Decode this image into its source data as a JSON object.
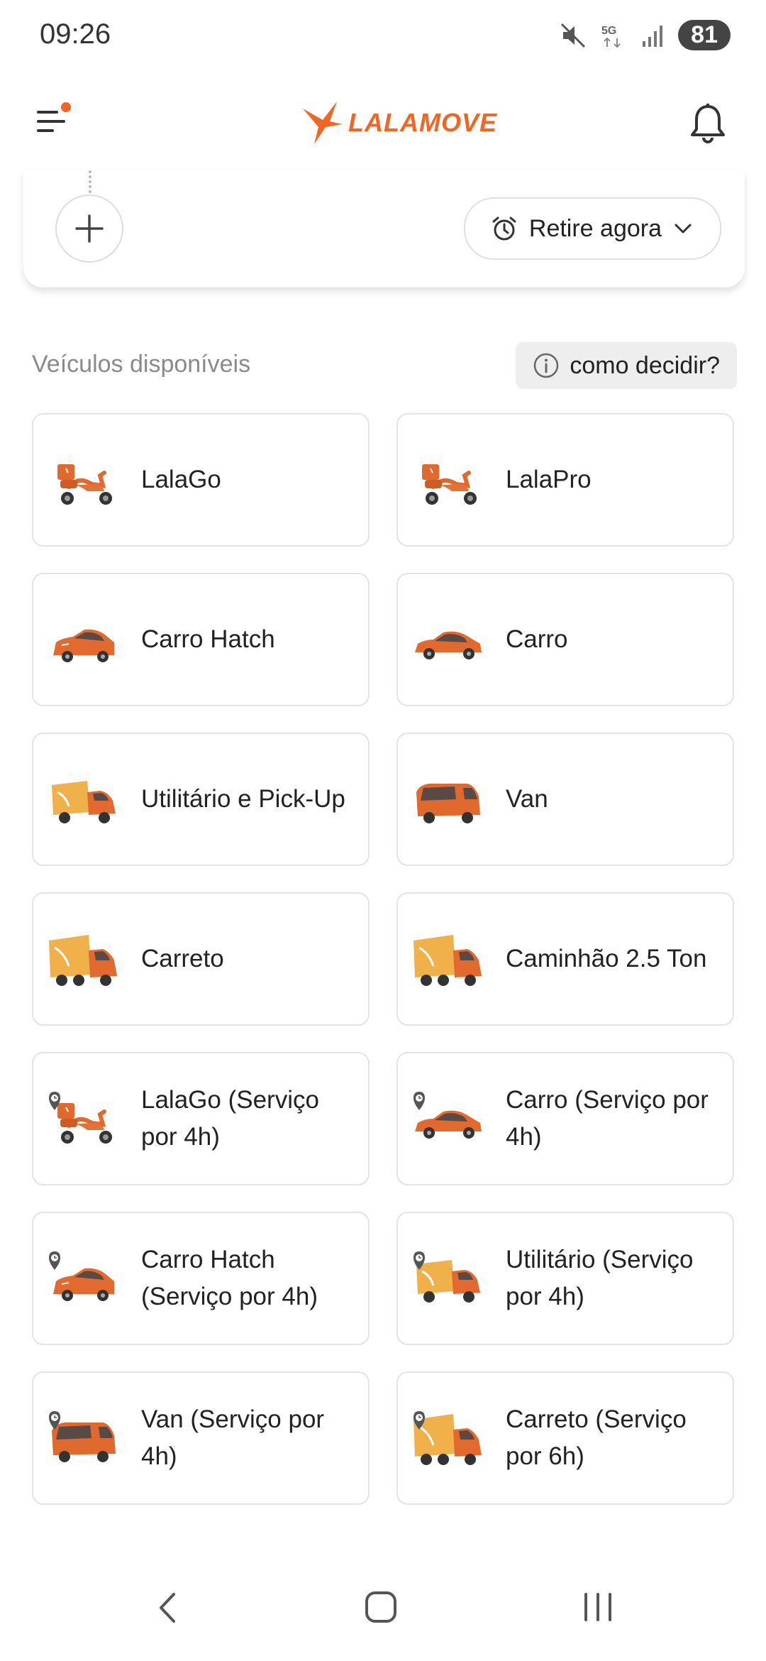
{
  "status_bar": {
    "time": "09:26",
    "battery": "81",
    "network": "5G",
    "icons": [
      "mute-icon",
      "5g-icon",
      "signal-icon",
      "battery-icon"
    ]
  },
  "header": {
    "brand": "LALAMOVE",
    "brand_color": "#f16622",
    "icons": [
      "menu-icon",
      "notification-bell-icon"
    ]
  },
  "order_card": {
    "pickup_time_label": "Retire agora",
    "icons": [
      "add-icon",
      "alarm-clock-icon",
      "chevron-down-icon"
    ]
  },
  "vehicles_section": {
    "title": "Veículos disponíveis",
    "help_label": "como decidir?",
    "help_icon": "info-icon",
    "items": [
      {
        "label": "LalaGo",
        "icon": "scooter-icon",
        "timed": false
      },
      {
        "label": "LalaPro",
        "icon": "scooter-icon",
        "timed": false
      },
      {
        "label": "Carro Hatch",
        "icon": "hatchback-car-icon",
        "timed": false
      },
      {
        "label": "Carro",
        "icon": "sedan-car-icon",
        "timed": false
      },
      {
        "label": "Utilitário e Pick-Up",
        "icon": "utility-truck-icon",
        "timed": false
      },
      {
        "label": "Van",
        "icon": "van-icon",
        "timed": false
      },
      {
        "label": "Carreto",
        "icon": "box-truck-icon",
        "timed": false
      },
      {
        "label": "Caminhão 2.5 Ton",
        "icon": "box-truck-icon",
        "timed": false
      },
      {
        "label": "LalaGo (Serviço por 4h)",
        "icon": "scooter-icon",
        "timed": true
      },
      {
        "label": "Carro (Serviço por 4h)",
        "icon": "sedan-car-icon",
        "timed": true
      },
      {
        "label": "Carro Hatch (Serviço por 4h)",
        "icon": "hatchback-car-icon",
        "timed": true
      },
      {
        "label": "Utilitário (Serviço por 4h)",
        "icon": "utility-truck-icon",
        "timed": true
      },
      {
        "label": "Van (Serviço por 4h)",
        "icon": "van-icon",
        "timed": true
      },
      {
        "label": "Carreto (Serviço por 6h)",
        "icon": "box-truck-icon",
        "timed": true
      }
    ]
  },
  "nav_bar": {
    "icons": [
      "back-icon",
      "home-icon",
      "recent-apps-icon"
    ]
  }
}
